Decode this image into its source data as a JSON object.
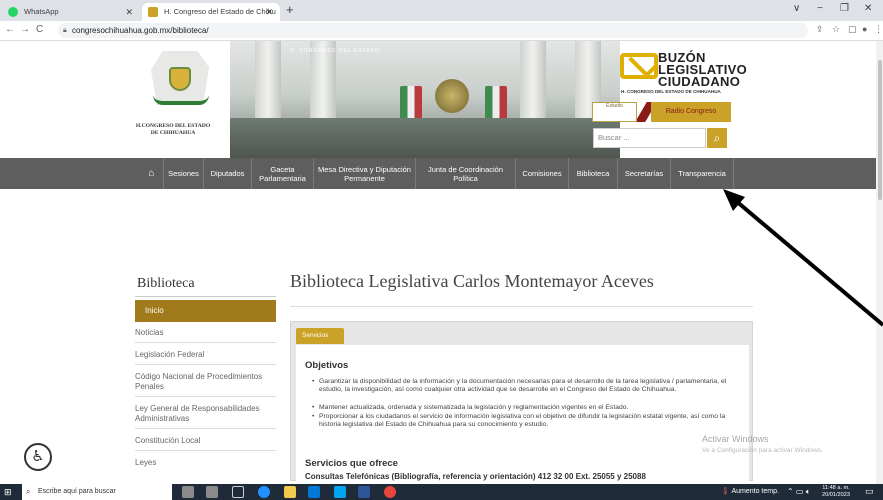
{
  "browser": {
    "tabs": [
      {
        "label": "WhatsApp",
        "active": false
      },
      {
        "label": "H. Congreso del Estado de Chihu",
        "active": true
      }
    ],
    "new_tab": "+",
    "url": "congresochihuahua.gob.mx/biblioteca/",
    "nav": {
      "back": "←",
      "forward": "→",
      "reload": "C"
    },
    "window": {
      "collapse": "∨",
      "minimize": "−",
      "maximize": "❐",
      "close": "✕"
    },
    "toolbar_icons": {
      "share": "⇪",
      "star": "☆",
      "sidebar": "▢",
      "profile": "●",
      "menu": "⋮"
    }
  },
  "header": {
    "logo_text": "H.CONGRESO DEL ESTADO DE CHIHUAHUA",
    "banner_text": "H. CONGRESO DEL ESTADO",
    "buzon": [
      "BUZÓN",
      "LEGISLATIVO",
      "CIUDADANO"
    ],
    "buzon_sub": "H. CONGRESO DEL ESTADO DE CHIHUAHUA",
    "radio_small": "Estudio",
    "radio_label": "Radio Congreso",
    "search_placeholder": "Buscar ..."
  },
  "nav": {
    "home_icon": "home-icon",
    "items": [
      "Sesiones",
      "Diputados",
      "Gaceta Parlamentaria",
      "Mesa Directiva y Diputación Permanente",
      "Junta de Coordinación Política",
      "Comisiones",
      "Biblioteca",
      "Secretarías",
      "Transparencia"
    ]
  },
  "sidebar": {
    "title": "Biblioteca",
    "items": [
      "Inicio",
      "Noticias",
      "Legislación Federal",
      "Código Nacional de Procedimientos Penales",
      "Ley General de Responsabilidades Administrativas",
      "Constitución Local",
      "Leyes"
    ]
  },
  "main": {
    "title": "Biblioteca Legislativa Carlos Montemayor Aceves",
    "tab": "Servicios",
    "objectives_title": "Objetivos",
    "objectives": [
      "Garantizar la disponibilidad de la información y la documentación necesarias para el desarrollo de la tarea legislativa / parlamentaria, el estudio, la investigación, así como cualquier otra actividad que se desarrolle en el Congreso del Estado de Chihuahua.",
      "Mantener actualizada, ordenada y sistematizada la legislación y reglamentación vigentes en el Estado.",
      "Proporcionar a los ciudadanos el servicio de información legislativa con el objetivo de difundir la legislación estatal vigente, así como la historia legislativa del Estado de Chihuahua para su conocimiento y estudio."
    ],
    "services_title": "Servicios que ofrece",
    "services_text": "Consultas Telefónicas (Bibliografía, referencia y orientación) 412 32 00 Ext. 25055 y 25088"
  },
  "watermark": {
    "line1": "Activar Windows",
    "line2": "Ve a Configuración para activar Windows."
  },
  "taskbar": {
    "search_placeholder": "Escribe aquí para buscar",
    "weather": "Aumento temp.",
    "time": "11:48 a. m.",
    "date": "20/01/2023"
  },
  "colors": {
    "gold": "#c9a227",
    "sidebar_active": "#a07a1b",
    "nav_bg": "#5e5e5e",
    "taskbar": "#1f2b38"
  }
}
